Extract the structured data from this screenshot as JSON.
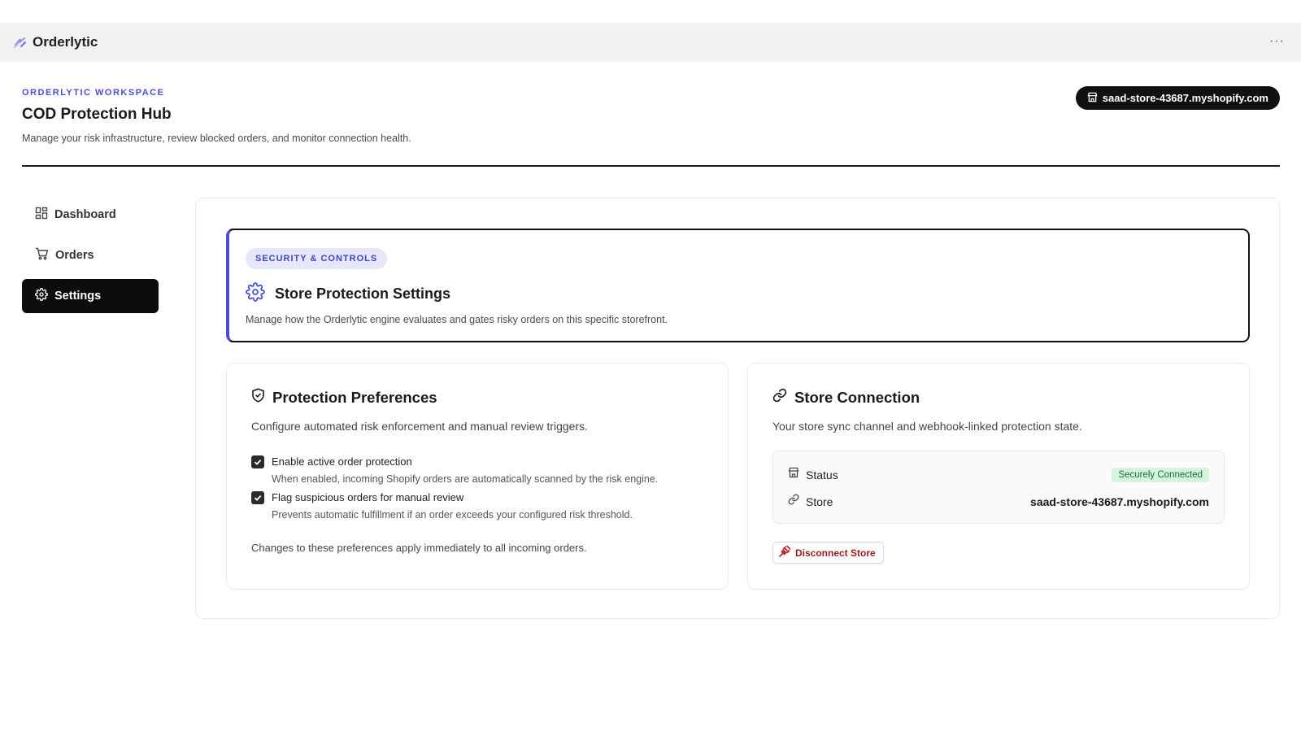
{
  "app": {
    "title": "Orderlytic",
    "more_label": "···"
  },
  "header": {
    "eyebrow": "ORDERLYTIC WORKSPACE",
    "title": "COD Protection Hub",
    "subtitle": "Manage your risk infrastructure, review blocked orders, and monitor connection health.",
    "store_pill": "saad-store-43687.myshopify.com"
  },
  "sidebar": {
    "items": [
      {
        "label": "Dashboard",
        "icon": "dashboard-icon",
        "active": false
      },
      {
        "label": "Orders",
        "icon": "cart-icon",
        "active": false
      },
      {
        "label": "Settings",
        "icon": "gear-icon",
        "active": true
      }
    ]
  },
  "hero": {
    "badge": "SECURITY & CONTROLS",
    "title": "Store Protection Settings",
    "subtitle": "Manage how the Orderlytic engine evaluates and gates risky orders on this specific storefront."
  },
  "preferences": {
    "title": "Protection Preferences",
    "subtitle": "Configure automated risk enforcement and manual review triggers.",
    "options": [
      {
        "label": "Enable active order protection",
        "description": "When enabled, incoming Shopify orders are automatically scanned by the risk engine.",
        "checked": true
      },
      {
        "label": "Flag suspicious orders for manual review",
        "description": "Prevents automatic fulfillment if an order exceeds your configured risk threshold.",
        "checked": true
      }
    ],
    "note": "Changes to these preferences apply immediately to all incoming orders."
  },
  "connection": {
    "title": "Store Connection",
    "subtitle": "Your store sync channel and webhook-linked protection state.",
    "status_label": "Status",
    "status_value": "Securely Connected",
    "store_label": "Store",
    "store_value": "saad-store-43687.myshopify.com",
    "disconnect_label": "Disconnect Store"
  },
  "colors": {
    "accent": "#4b4fd6",
    "active_nav": "#0d0d0d",
    "success_bg": "#d3f5dd",
    "success_text": "#1d6b35",
    "danger": "#9b1c1c"
  }
}
